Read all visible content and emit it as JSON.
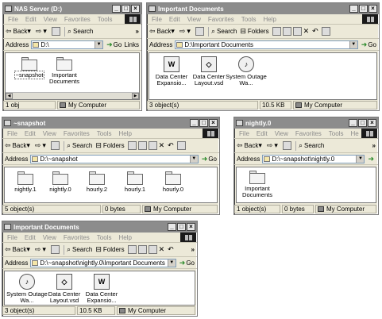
{
  "menu_labels": {
    "file": "File",
    "edit": "Edit",
    "view": "View",
    "favorites": "Favorites",
    "tools": "Tools",
    "help": "Help",
    "help_truncated": "He"
  },
  "toolbar": {
    "back": "Back",
    "search": "Search",
    "folders": "Folders",
    "chevron": "»"
  },
  "address_label": "Address",
  "go_label": "Go",
  "links_label": "Links",
  "status_location": "My Computer",
  "win1": {
    "title": "NAS Server (D:)",
    "address": "D:\\",
    "files": [
      {
        "label": "~snapshot",
        "selected": true
      },
      {
        "label": "Important Documents"
      }
    ],
    "status_objects": "1 obj",
    "status_location": "My Computer"
  },
  "win2": {
    "title": "Important Documents",
    "address": "D:\\Important Documents",
    "files": [
      {
        "label": "Data Center Expansio...",
        "icon": "word-doc-icon"
      },
      {
        "label": "Data Center Layout.vsd",
        "icon": "visio-doc-icon"
      },
      {
        "label": "System Outage Wa...",
        "icon": "sound-file-icon"
      }
    ],
    "status_objects": "3 object(s)",
    "status_size": "10.5 KB"
  },
  "win3": {
    "title": "~snapshot",
    "address": "D:\\~snapshot",
    "files": [
      {
        "label": "nightly.1"
      },
      {
        "label": "nightly.0"
      },
      {
        "label": "hourly.2"
      },
      {
        "label": "hourly.1"
      },
      {
        "label": "hourly.0"
      }
    ],
    "status_objects": "5 object(s)",
    "status_size": "0 bytes"
  },
  "win4": {
    "title": "nightly.0",
    "address": "D:\\~snapshot\\nightly.0",
    "files": [
      {
        "label": "Important Documents"
      }
    ],
    "status_objects": "1 object(s)",
    "status_size": "0 bytes"
  },
  "win5": {
    "title": "Important Documents",
    "address": "D:\\~snapshot\\nightly.0\\Important Documents",
    "files": [
      {
        "label": "System Outage Wa...",
        "icon": "sound-file-icon"
      },
      {
        "label": "Data Center Layout.vsd",
        "icon": "visio-doc-icon"
      },
      {
        "label": "Data Center Expansio...",
        "icon": "word-doc-icon"
      }
    ],
    "status_objects": "3 object(s)",
    "status_size": "10.5 KB"
  }
}
